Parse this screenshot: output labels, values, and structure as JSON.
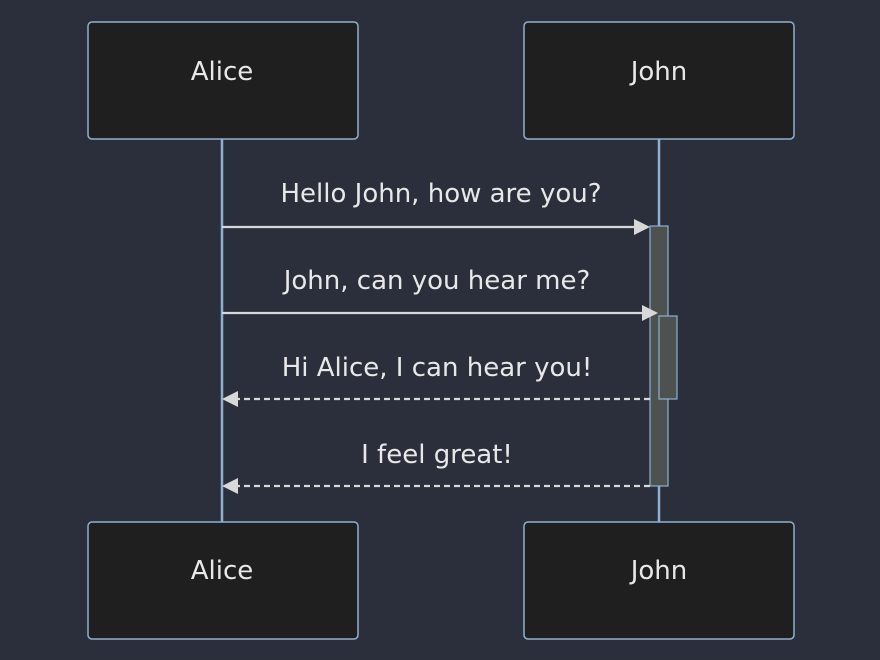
{
  "colors": {
    "background": "#2b2f3b",
    "actor_fill": "#1f1f1f",
    "actor_border": "#8fb0d0",
    "line": "#d8d8d8",
    "activation_fill": "#4d5250",
    "text": "#e8e8e8"
  },
  "actors": [
    {
      "id": "alice",
      "label": "Alice"
    },
    {
      "id": "john",
      "label": "John"
    }
  ],
  "messages": [
    {
      "from": "alice",
      "to": "john",
      "label": "Hello John, how are you?",
      "style": "solid"
    },
    {
      "from": "alice",
      "to": "john",
      "label": "John, can you hear me?",
      "style": "solid"
    },
    {
      "from": "john",
      "to": "alice",
      "label": "Hi Alice, I can hear you!",
      "style": "dashed"
    },
    {
      "from": "john",
      "to": "alice",
      "label": "I feel great!",
      "style": "dashed"
    }
  ]
}
